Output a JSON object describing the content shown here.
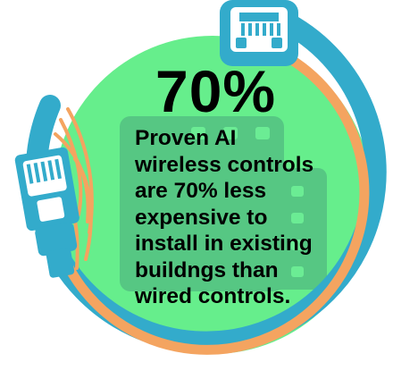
{
  "stat": "70%",
  "lines": [
    "Proven AI",
    "wireless controls",
    "are 70% less",
    "expensive to",
    "install in existing",
    "buildngs than",
    "wired controls."
  ],
  "colors": {
    "circle": "#66EE8C",
    "outer_ring": "#33ABCB",
    "cable": "#F4A460",
    "building": "#56C783",
    "text": "#000000"
  },
  "icons": [
    "ethernet-port-icon",
    "ethernet-plug-icon",
    "building-icon"
  ]
}
